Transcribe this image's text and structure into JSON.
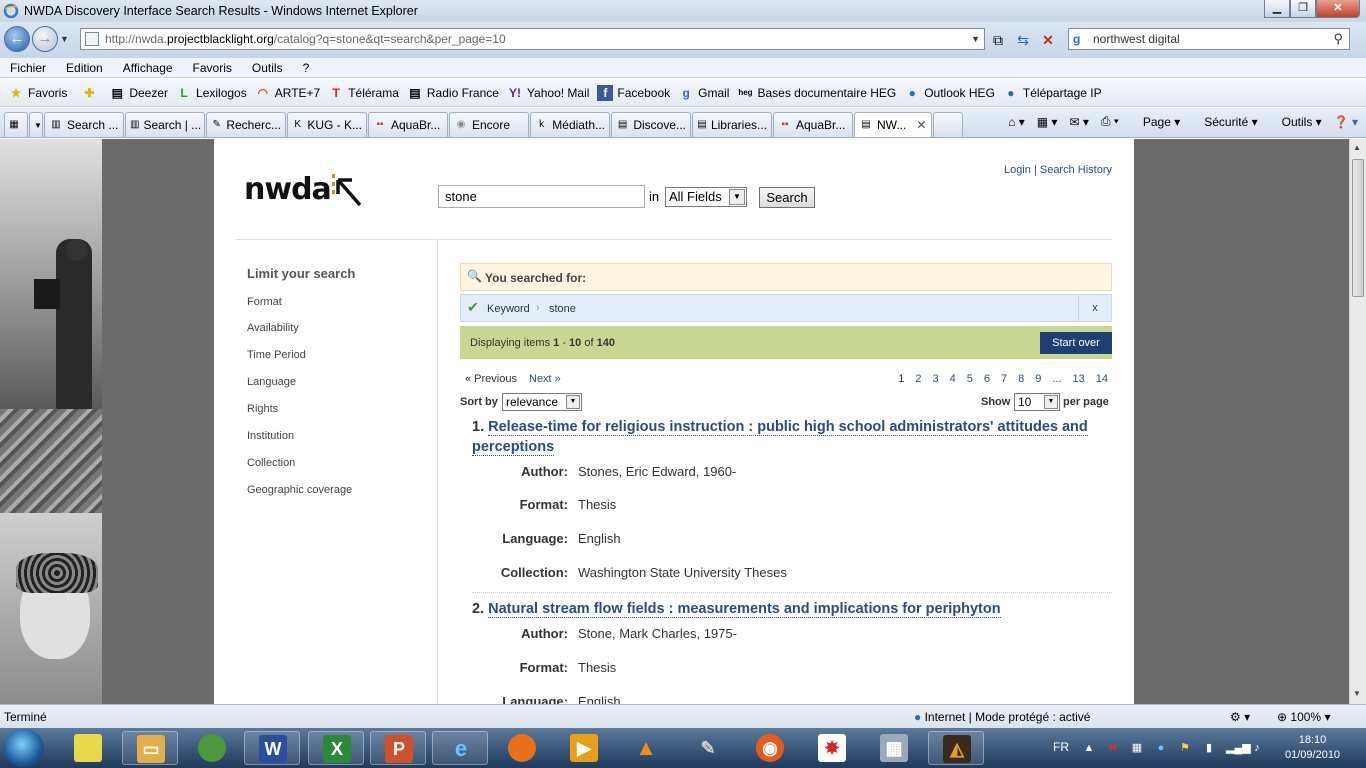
{
  "window": {
    "title": "NWDA Discovery Interface Search Results - Windows Internet Explorer",
    "url_prefix": "http://nwda.",
    "url_domain": "projectblacklight.org",
    "url_path": "/catalog?q=stone&qt=search&per_page=10",
    "search_text": "northwest digital"
  },
  "menu": [
    "Fichier",
    "Edition",
    "Affichage",
    "Favoris",
    "Outils",
    "?"
  ],
  "favorites": {
    "label": "Favoris",
    "items": [
      "Deezer",
      "Lexilogos",
      "ARTE+7",
      "Télérama",
      "Radio France",
      "Yahoo! Mail",
      "Facebook",
      "Gmail",
      "Bases documentaire HEG",
      "Outlook HEG",
      "Télépartage IP"
    ]
  },
  "tabs": [
    "Search ...",
    "Search | ...",
    "Recherc...",
    "KUG - K...",
    "AquaBr...",
    "Encore",
    "Médiath...",
    "Discove...",
    "Libraries...",
    "AquaBr...",
    "NW..."
  ],
  "commands": [
    "Page",
    "Sécurité",
    "Outils"
  ],
  "site": {
    "logo": "nwda",
    "search_value": "stone",
    "in_label": "in",
    "field_selected": "All Fields",
    "search_button": "Search",
    "login": "Login",
    "history": "Search History",
    "limit_title": "Limit your search",
    "facets": [
      "Format",
      "Availability",
      "Time Period",
      "Language",
      "Rights",
      "Institution",
      "Collection",
      "Geographic coverage"
    ],
    "you_searched": "You searched for:",
    "constraint_key": "Keyword",
    "constraint_value": "stone",
    "constraint_remove": "x",
    "display_prefix": "Displaying items ",
    "display_from": "1",
    "display_dash": " - ",
    "display_to": "10",
    "display_of": " of ",
    "display_total": "140",
    "start_over": "Start over",
    "prev": "« Previous",
    "next": "Next »",
    "pages": [
      "1",
      "2",
      "3",
      "4",
      "5",
      "6",
      "7",
      "8",
      "9",
      "...",
      "13",
      "14"
    ],
    "sort_label": "Sort by",
    "sort_value": "relevance",
    "show_label": "Show",
    "show_value": "10",
    "perpage_label": "per page",
    "results": [
      {
        "num": "1.",
        "title": "Release-time for religious instruction : public high school administrators' attitudes and perceptions",
        "fields": [
          {
            "label": "Author:",
            "value": "Stones, Eric Edward, 1960-"
          },
          {
            "label": "Format:",
            "value": "Thesis"
          },
          {
            "label": "Language:",
            "value": "English"
          },
          {
            "label": "Collection:",
            "value": "Washington State University Theses"
          }
        ]
      },
      {
        "num": "2.",
        "title": "Natural stream flow fields : measurements and implications for periphyton",
        "fields": [
          {
            "label": "Author:",
            "value": "Stone, Mark Charles, 1975-"
          },
          {
            "label": "Format:",
            "value": "Thesis"
          },
          {
            "label": "Language:",
            "value": "English"
          }
        ]
      }
    ]
  },
  "status": {
    "text": "Terminé",
    "zone": "Internet | Mode protégé : activé",
    "zoom": "100%"
  },
  "taskbar": {
    "lang": "FR",
    "time": "18:10",
    "date": "01/09/2010"
  }
}
